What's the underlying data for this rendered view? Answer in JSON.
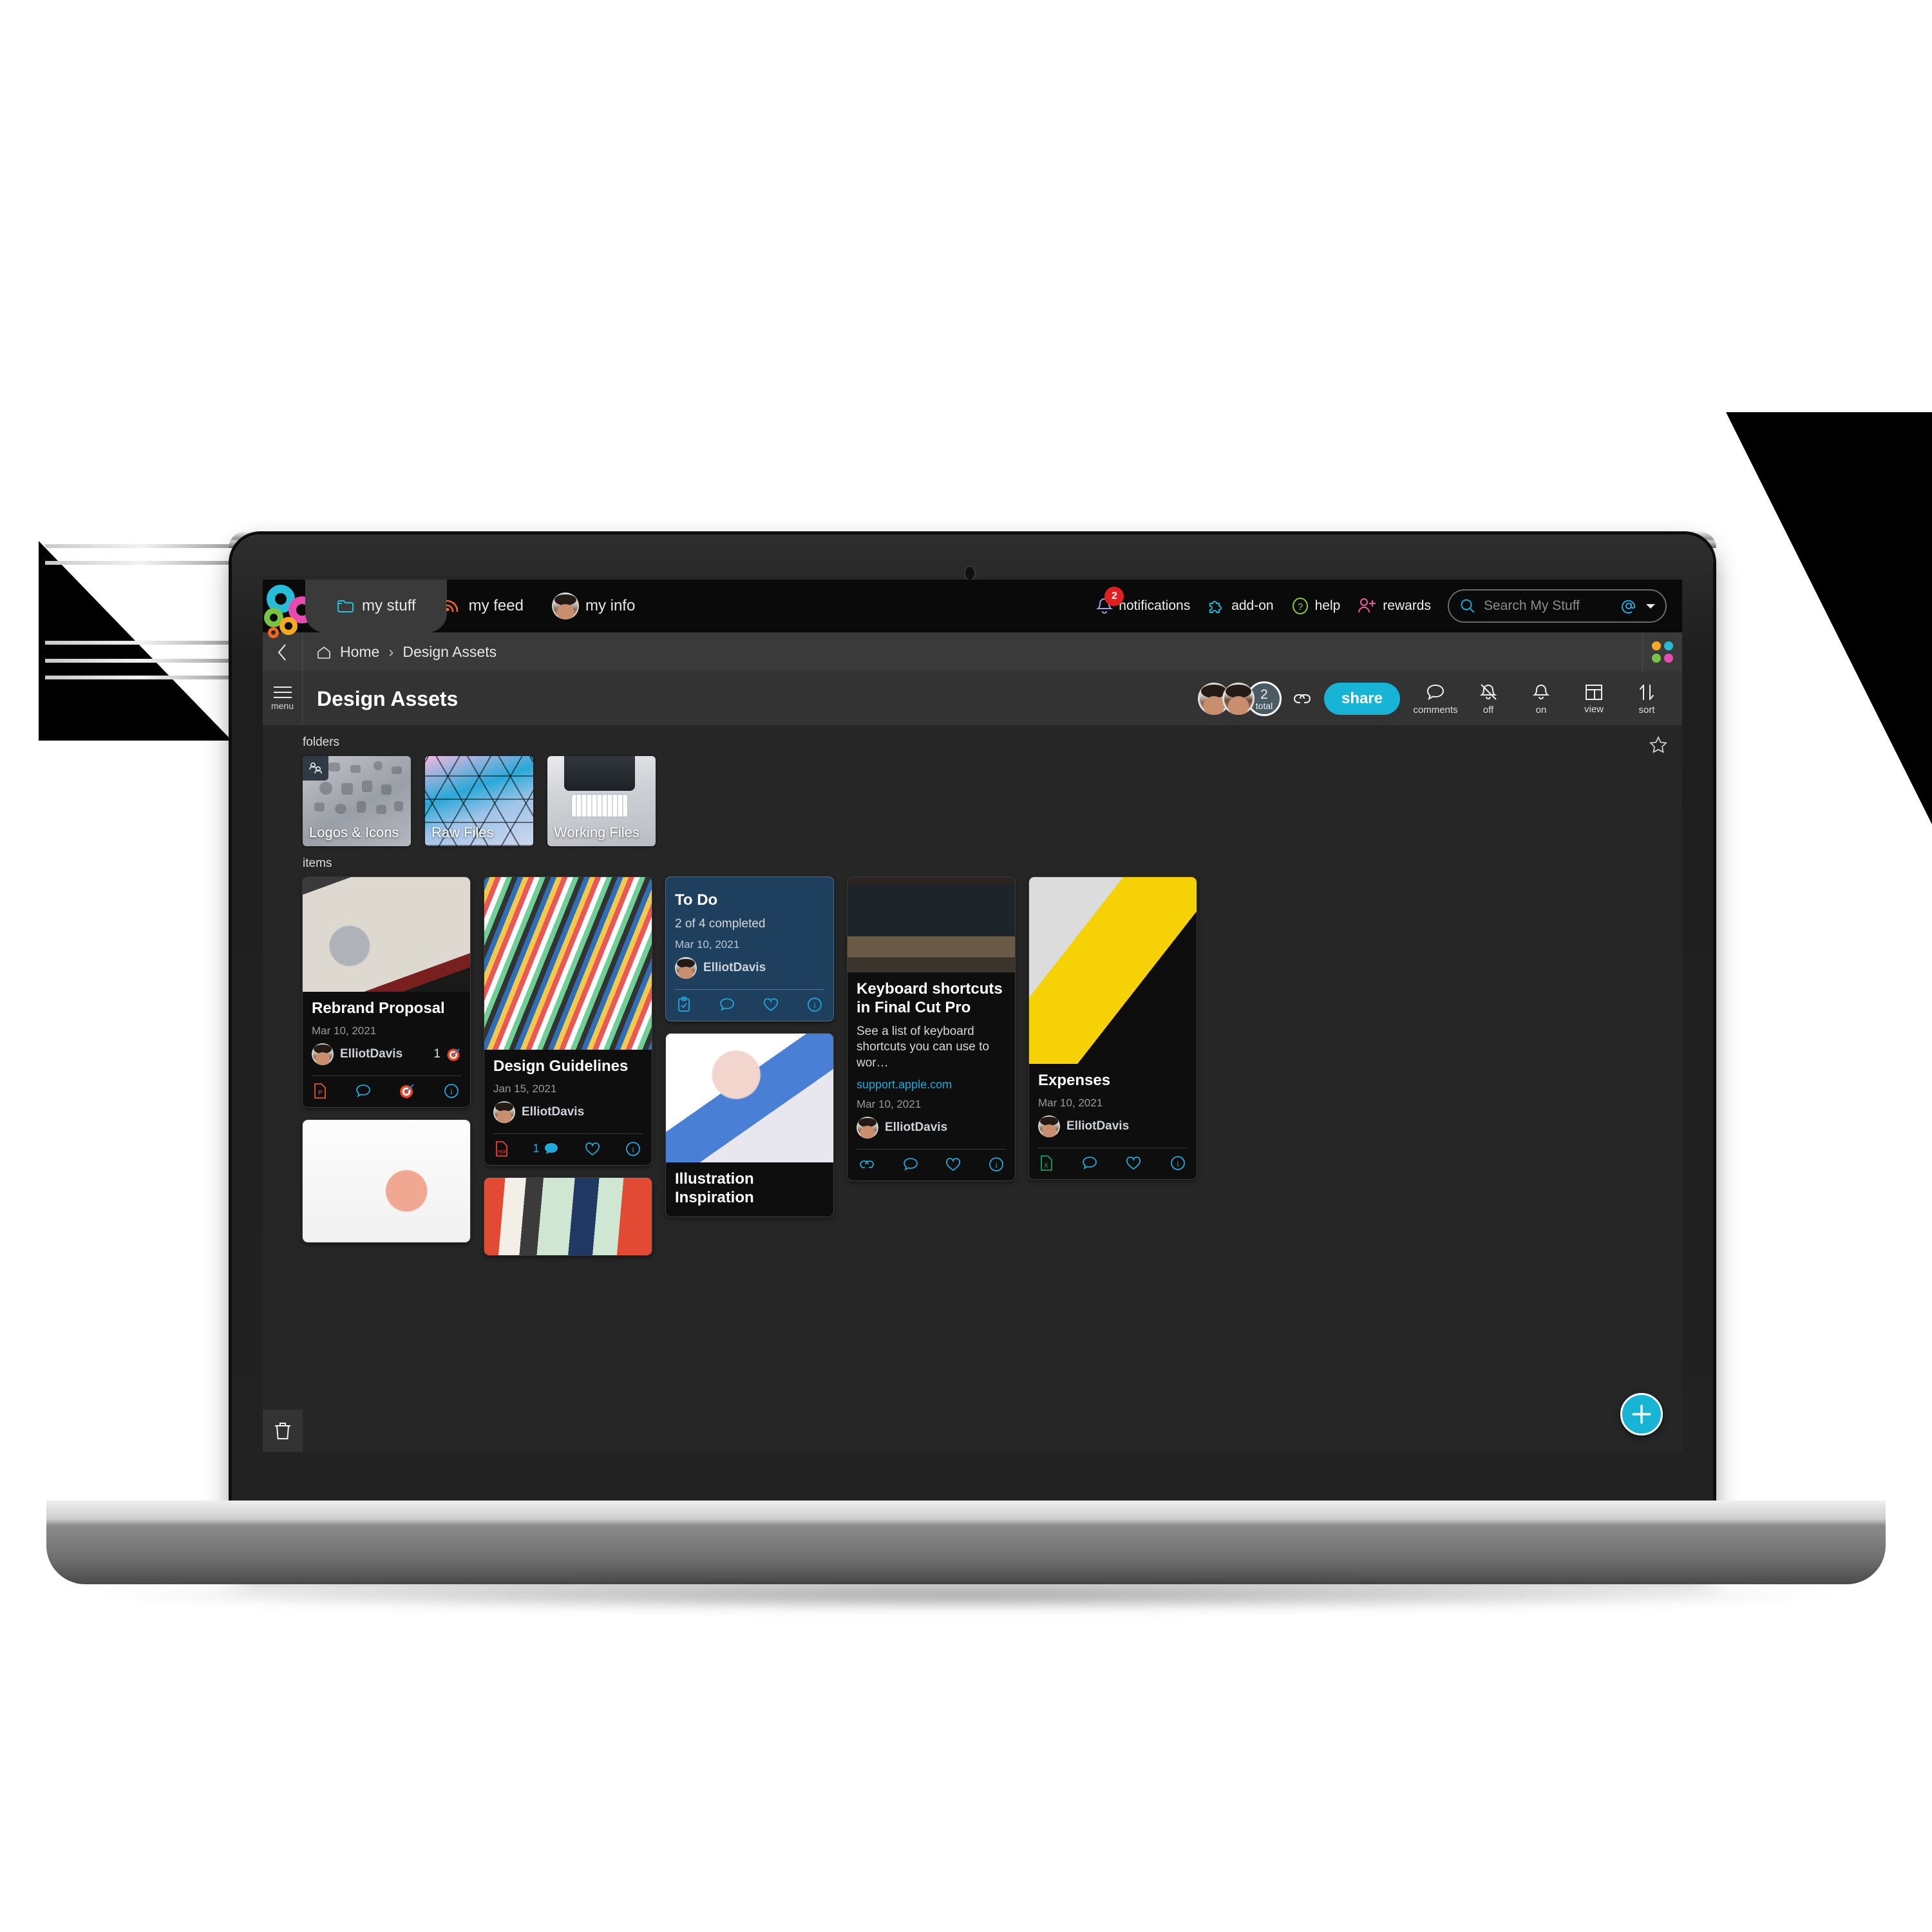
{
  "app": {
    "logo_name": "colored-rings-logo",
    "tabs": [
      {
        "id": "my-stuff",
        "label": "my stuff",
        "icon": "folder-icon",
        "active": true
      },
      {
        "id": "my-feed",
        "label": "my feed",
        "icon": "rss-icon",
        "active": false
      },
      {
        "id": "my-info",
        "label": "my info",
        "icon": "user-avatar",
        "active": false
      }
    ],
    "nav_right": [
      {
        "id": "notifications",
        "label": "notifications",
        "icon": "bell-icon",
        "badge": "2"
      },
      {
        "id": "add-on",
        "label": "add-on",
        "icon": "puzzle-icon",
        "badge": ""
      },
      {
        "id": "help",
        "label": "help",
        "icon": "question-circle-icon",
        "badge": ""
      },
      {
        "id": "rewards",
        "label": "rewards",
        "icon": "user-plus-icon",
        "badge": ""
      }
    ],
    "search": {
      "placeholder": "Search My Stuff",
      "value": "",
      "icon": "search-icon",
      "at_icon": "at-icon",
      "caret_icon": "chevron-down-icon"
    }
  },
  "breadcrumb": {
    "back_icon": "chevron-left-icon",
    "home_icon": "home-icon",
    "items": [
      "Home",
      "Design Assets"
    ],
    "separator": "›",
    "dots_colors": [
      "#f7a823",
      "#25bdd8",
      "#79c242",
      "#e84ab3"
    ]
  },
  "titlebar": {
    "menu_label": "menu",
    "menu_icon": "hamburger-icon",
    "title": "Design Assets",
    "collaborators": {
      "count": "2",
      "count_label": "total"
    },
    "link_icon": "link-icon",
    "share_label": "share",
    "tools": [
      {
        "id": "comments",
        "label": "comments",
        "icon": "comment-icon"
      },
      {
        "id": "notifications-off",
        "label": "off",
        "icon": "bell-slash-icon"
      },
      {
        "id": "alerts-on",
        "label": "on",
        "icon": "bell-icon"
      },
      {
        "id": "view",
        "label": "view",
        "icon": "layout-icon"
      },
      {
        "id": "sort",
        "label": "sort",
        "icon": "sort-arrows-icon"
      }
    ]
  },
  "content": {
    "folders_label": "folders",
    "items_label": "items",
    "favorite_icon": "star-outline-icon",
    "trash_icon": "trash-icon",
    "add_icon": "plus-icon",
    "folders": [
      {
        "name": "Logos & Icons",
        "shared": true,
        "shared_icon": "people-icon"
      },
      {
        "name": "Raw Files",
        "shared": false,
        "shared_icon": ""
      },
      {
        "name": "Working Files",
        "shared": false,
        "shared_icon": ""
      }
    ],
    "items": [
      {
        "id": "rebrand-proposal",
        "title": "Rebrand Proposal",
        "date": "Mar 10, 2021",
        "user": "ElliotDavis",
        "count": "1",
        "count_icon": "target-icon",
        "thumb": "notebook-sketch-photo",
        "actions": [
          "powerpoint-file-icon",
          "comment-icon",
          "target-icon",
          "info-icon"
        ]
      },
      {
        "id": "piggy-bank",
        "title": "",
        "date": "",
        "user": "",
        "count": "",
        "count_icon": "",
        "thumb": "piggy-bank-photo",
        "actions": []
      },
      {
        "id": "design-guidelines",
        "title": "Design Guidelines",
        "date": "Jan 15, 2021",
        "user": "ElliotDavis",
        "count": "1",
        "count_icon": "",
        "thumb": "color-swatches-photo",
        "actions": [
          "pdf-file-icon",
          "comment-filled-icon",
          "heart-icon",
          "info-icon"
        ],
        "comment_count": "1"
      },
      {
        "id": "to-do",
        "title": "To Do",
        "subtitle": "2 of 4 completed",
        "date": "Mar 10, 2021",
        "user": "ElliotDavis",
        "actions": [
          "checklist-icon",
          "comment-icon",
          "heart-icon",
          "info-icon"
        ]
      },
      {
        "id": "illustration-inspiration",
        "title": "Illustration Inspiration",
        "thumb": "illustration-portrait-photo",
        "actions": []
      },
      {
        "id": "keyboard-shortcuts",
        "title": "Keyboard shortcuts in Final Cut Pro",
        "subtitle": "See a list of keyboard shortcuts you can use to wor…",
        "link": "support.apple.com",
        "date": "Mar 10, 2021",
        "user": "ElliotDavis",
        "thumb": "video-editing-desk-photo",
        "actions": [
          "link-icon",
          "comment-icon",
          "heart-icon",
          "info-icon"
        ]
      },
      {
        "id": "expenses",
        "title": "Expenses",
        "date": "Mar 10, 2021",
        "user": "ElliotDavis",
        "thumb": "keyboard-yellow-desk-photo",
        "actions": [
          "excel-file-icon",
          "comment-icon",
          "heart-icon",
          "info-icon"
        ]
      }
    ]
  },
  "colors": {
    "accent": "#17b4d6",
    "link": "#22a8da",
    "badge": "#e02020",
    "todo_card": "#1e405e",
    "screen_bg": "#262626",
    "topbar_bg": "#0a0a0a"
  }
}
